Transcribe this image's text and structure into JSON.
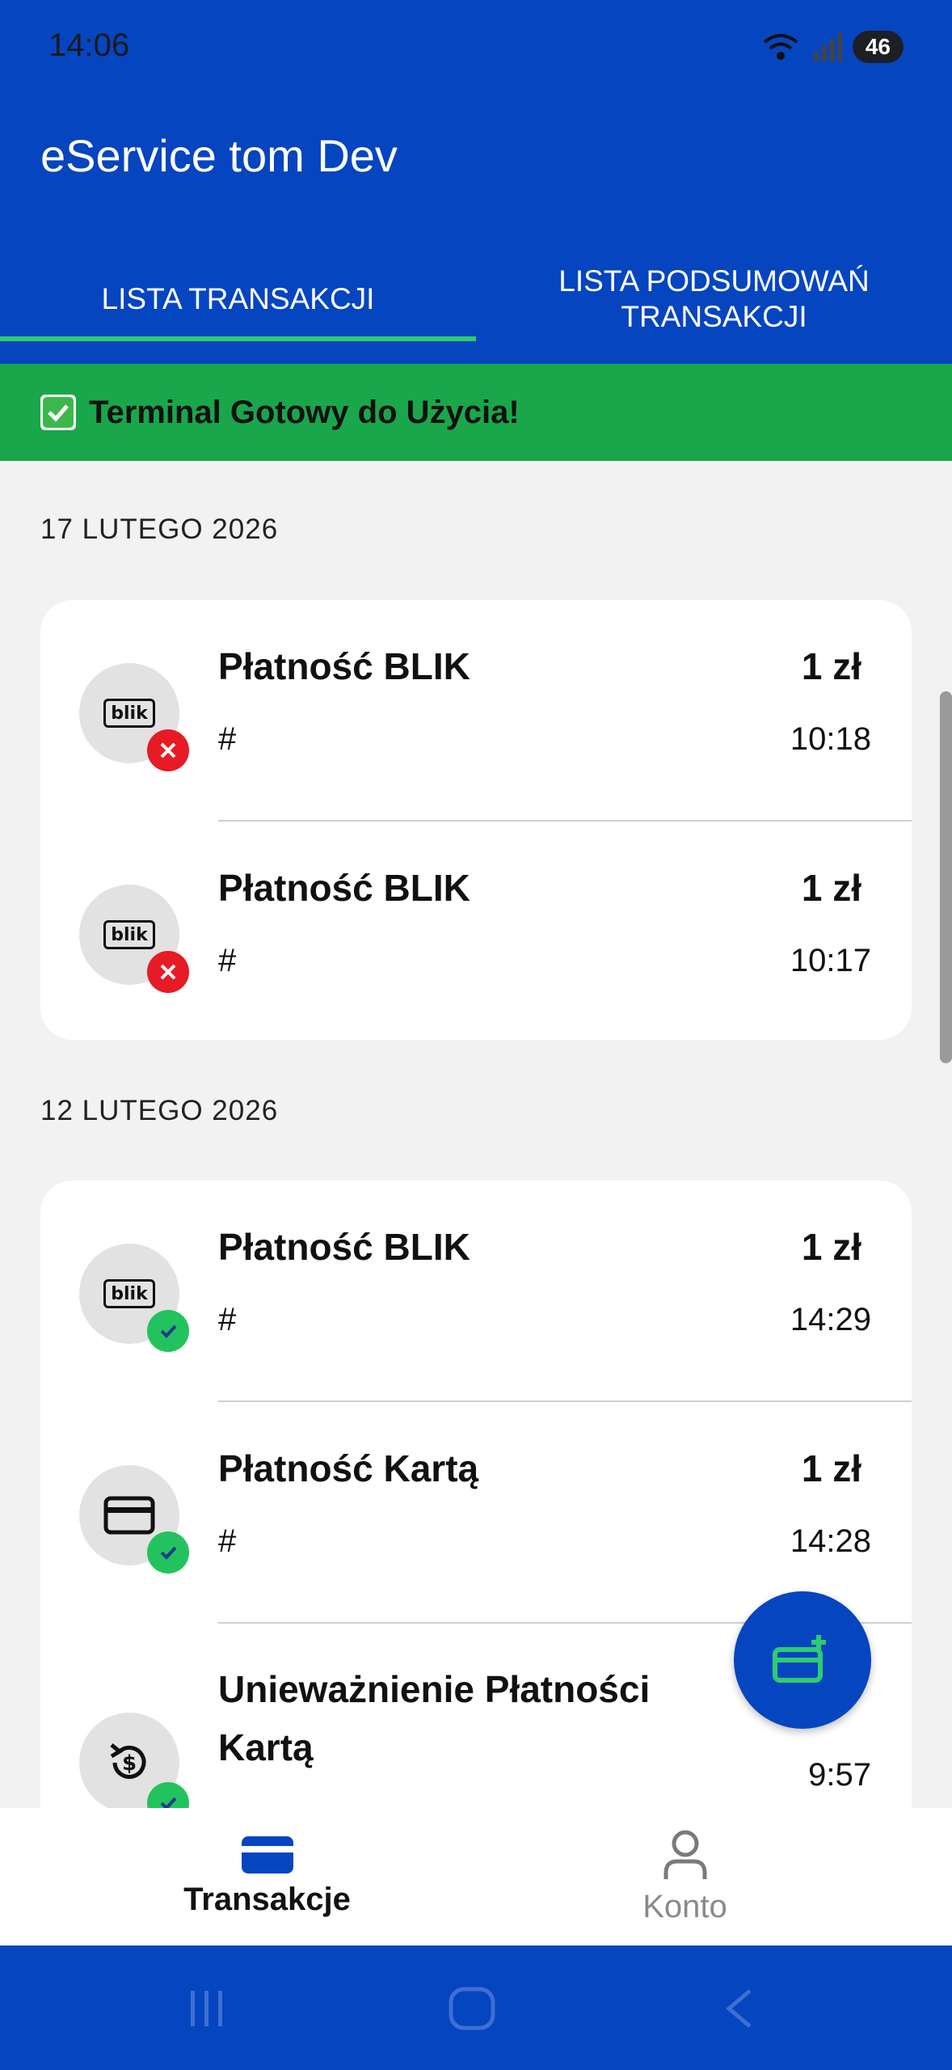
{
  "status_bar": {
    "time": "14:06",
    "battery": "46"
  },
  "app_title": "eService tom Dev",
  "tabs": [
    {
      "label": "LISTA TRANSAKCJI",
      "active": true
    },
    {
      "label_line1": "LISTA PODSUMOWAŃ",
      "label_line2": "TRANSAKCJI",
      "active": false
    }
  ],
  "banner": {
    "text": "Terminal Gotowy do Użycia!"
  },
  "groups": [
    {
      "date": "17 LUTEGO 2026",
      "items": [
        {
          "title": "Płatność BLIK",
          "amount": "1 zł",
          "ref": "#",
          "time": "10:18",
          "icon": "blik-icon",
          "status": "failed"
        },
        {
          "title": "Płatność BLIK",
          "amount": "1 zł",
          "ref": "#",
          "time": "10:17",
          "icon": "blik-icon",
          "status": "failed"
        }
      ]
    },
    {
      "date": "12 LUTEGO 2026",
      "items": [
        {
          "title": "Płatność BLIK",
          "amount": "1 zł",
          "ref": "#",
          "time": "14:29",
          "icon": "blik-icon",
          "status": "success"
        },
        {
          "title": "Płatność Kartą",
          "amount": "1 zł",
          "ref": "#",
          "time": "14:28",
          "icon": "card-icon",
          "status": "success"
        },
        {
          "title_line1": "Unieważnienie Płatności",
          "title_line2": "Kartą",
          "time": "9:57",
          "icon": "refund-icon",
          "status": "success"
        }
      ]
    }
  ],
  "icons": {
    "blik_text": "blik"
  },
  "bottom_nav": [
    {
      "label": "Transakcje",
      "icon": "card-icon",
      "active": true
    },
    {
      "label": "Konto",
      "icon": "user-icon",
      "active": false
    }
  ],
  "colors": {
    "primary": "#0645c0",
    "success": "#1aa64b",
    "error": "#e61b25",
    "accent": "#2ecc71"
  }
}
